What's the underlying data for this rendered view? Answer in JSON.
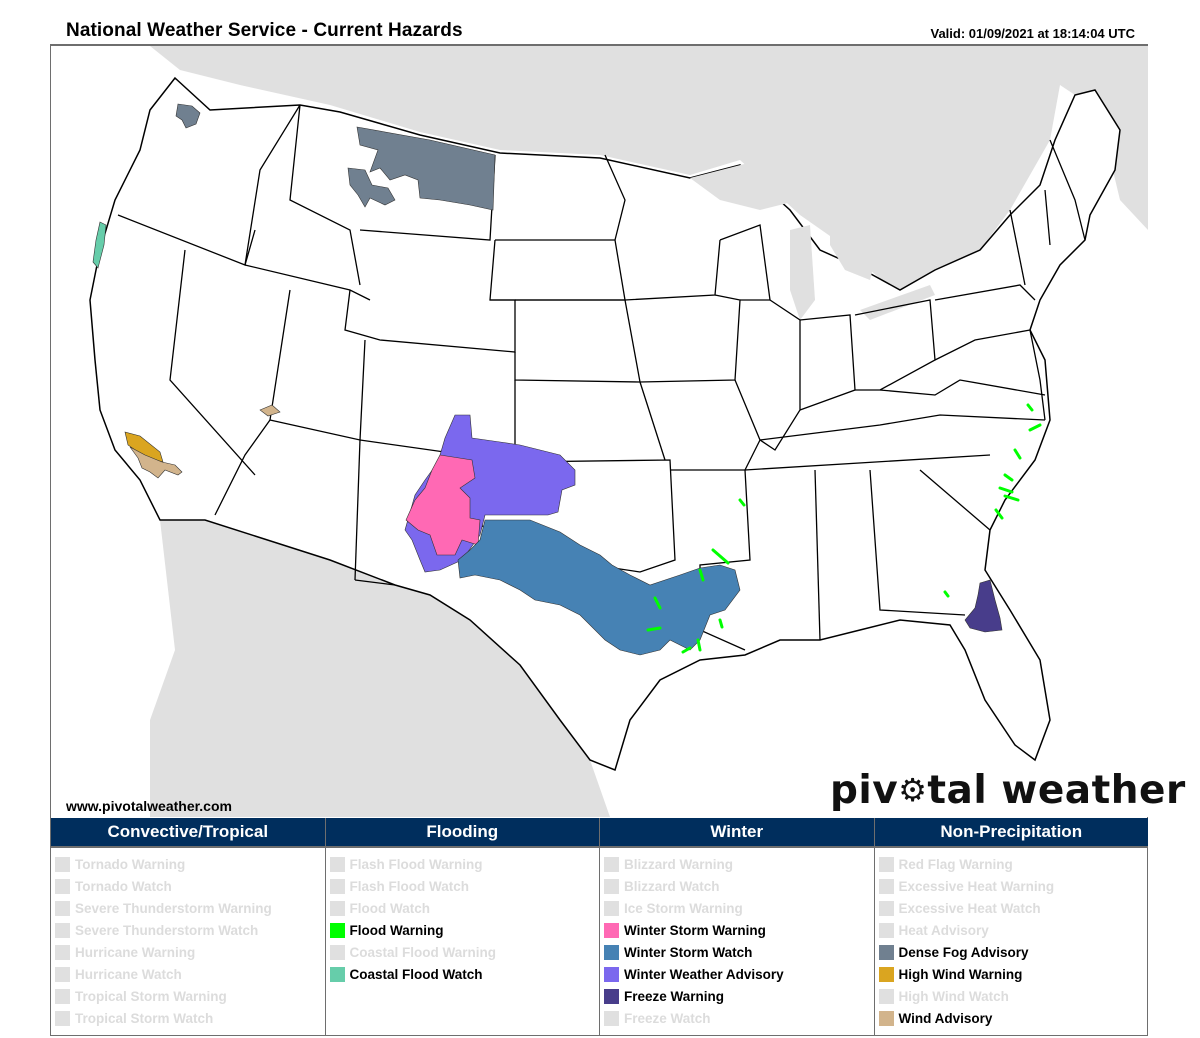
{
  "header": {
    "title": "National Weather Service - Current Hazards",
    "valid": "Valid: 01/09/2021 at 18:14:04 UTC"
  },
  "footer": {
    "site_url": "www.pivotalweather.com",
    "logo_left": "piv",
    "logo_right": "tal weather",
    "logo_gear": "⚙"
  },
  "legend": {
    "columns": [
      {
        "title": "Convective/Tropical",
        "items": [
          {
            "label": "Tornado Warning",
            "active": false,
            "color": "#e0e0e0"
          },
          {
            "label": "Tornado Watch",
            "active": false,
            "color": "#e0e0e0"
          },
          {
            "label": "Severe Thunderstorm Warning",
            "active": false,
            "color": "#e0e0e0"
          },
          {
            "label": "Severe Thunderstorm Watch",
            "active": false,
            "color": "#e0e0e0"
          },
          {
            "label": "Hurricane Warning",
            "active": false,
            "color": "#e0e0e0"
          },
          {
            "label": "Hurricane Watch",
            "active": false,
            "color": "#e0e0e0"
          },
          {
            "label": "Tropical Storm Warning",
            "active": false,
            "color": "#e0e0e0"
          },
          {
            "label": "Tropical Storm Watch",
            "active": false,
            "color": "#e0e0e0"
          }
        ]
      },
      {
        "title": "Flooding",
        "items": [
          {
            "label": "Flash Flood Warning",
            "active": false,
            "color": "#e0e0e0"
          },
          {
            "label": "Flash Flood Watch",
            "active": false,
            "color": "#e0e0e0"
          },
          {
            "label": "Flood Watch",
            "active": false,
            "color": "#e0e0e0"
          },
          {
            "label": "Flood Warning",
            "active": true,
            "color": "#00ff00"
          },
          {
            "label": "Coastal Flood Warning",
            "active": false,
            "color": "#e0e0e0"
          },
          {
            "label": "Coastal Flood Watch",
            "active": true,
            "color": "#66cdaa"
          }
        ]
      },
      {
        "title": "Winter",
        "items": [
          {
            "label": "Blizzard Warning",
            "active": false,
            "color": "#e0e0e0"
          },
          {
            "label": "Blizzard Watch",
            "active": false,
            "color": "#e0e0e0"
          },
          {
            "label": "Ice Storm Warning",
            "active": false,
            "color": "#e0e0e0"
          },
          {
            "label": "Winter Storm Warning",
            "active": true,
            "color": "#ff69b4"
          },
          {
            "label": "Winter Storm Watch",
            "active": true,
            "color": "#4682b4"
          },
          {
            "label": "Winter Weather Advisory",
            "active": true,
            "color": "#7b68ee"
          },
          {
            "label": "Freeze Warning",
            "active": true,
            "color": "#483d8b"
          },
          {
            "label": "Freeze Watch",
            "active": false,
            "color": "#e0e0e0"
          }
        ]
      },
      {
        "title": "Non-Precipitation",
        "items": [
          {
            "label": "Red Flag Warning",
            "active": false,
            "color": "#e0e0e0"
          },
          {
            "label": "Excessive Heat Warning",
            "active": false,
            "color": "#e0e0e0"
          },
          {
            "label": "Excessive Heat Watch",
            "active": false,
            "color": "#e0e0e0"
          },
          {
            "label": "Heat Advisory",
            "active": false,
            "color": "#e0e0e0"
          },
          {
            "label": "Dense Fog Advisory",
            "active": true,
            "color": "#708090"
          },
          {
            "label": "High Wind Warning",
            "active": true,
            "color": "#daa520"
          },
          {
            "label": "High Wind Watch",
            "active": false,
            "color": "#e0e0e0"
          },
          {
            "label": "Wind Advisory",
            "active": true,
            "color": "#d2b48c"
          }
        ]
      }
    ]
  },
  "map": {
    "background_land_foreign": "#e0e0e0",
    "land_us": "#ffffff",
    "state_border": "#000000",
    "county_border": "#b0b0b0",
    "hazard_areas": [
      {
        "hazard": "Dense Fog Advisory",
        "region": "Puget Sound, WA",
        "color": "#708090"
      },
      {
        "hazard": "Dense Fog Advisory",
        "region": "Northern & Central Montana",
        "color": "#708090"
      },
      {
        "hazard": "Coastal Flood Watch",
        "region": "Northern California Coast",
        "color": "#66cdaa"
      },
      {
        "hazard": "High Wind Warning",
        "region": "Southern California Mountains",
        "color": "#daa520"
      },
      {
        "hazard": "Wind Advisory",
        "region": "Southern California / Southern Nevada",
        "color": "#d2b48c"
      },
      {
        "hazard": "Winter Storm Warning",
        "region": "Southern Colorado / Northern New Mexico",
        "color": "#ff69b4"
      },
      {
        "hazard": "Winter Weather Advisory",
        "region": "Southern Colorado / NE New Mexico / W Kansas / Oklahoma Panhandle",
        "color": "#7b68ee"
      },
      {
        "hazard": "Winter Storm Watch",
        "region": "Texas Panhandle to North Texas and Arkansas / Louisiana",
        "color": "#4682b4"
      },
      {
        "hazard": "Flood Warning",
        "region": "Arkansas, Louisiana, Mississippi, Carolinas",
        "color": "#00ff00"
      },
      {
        "hazard": "Freeze Warning",
        "region": "Northeast Florida",
        "color": "#483d8b"
      }
    ]
  }
}
